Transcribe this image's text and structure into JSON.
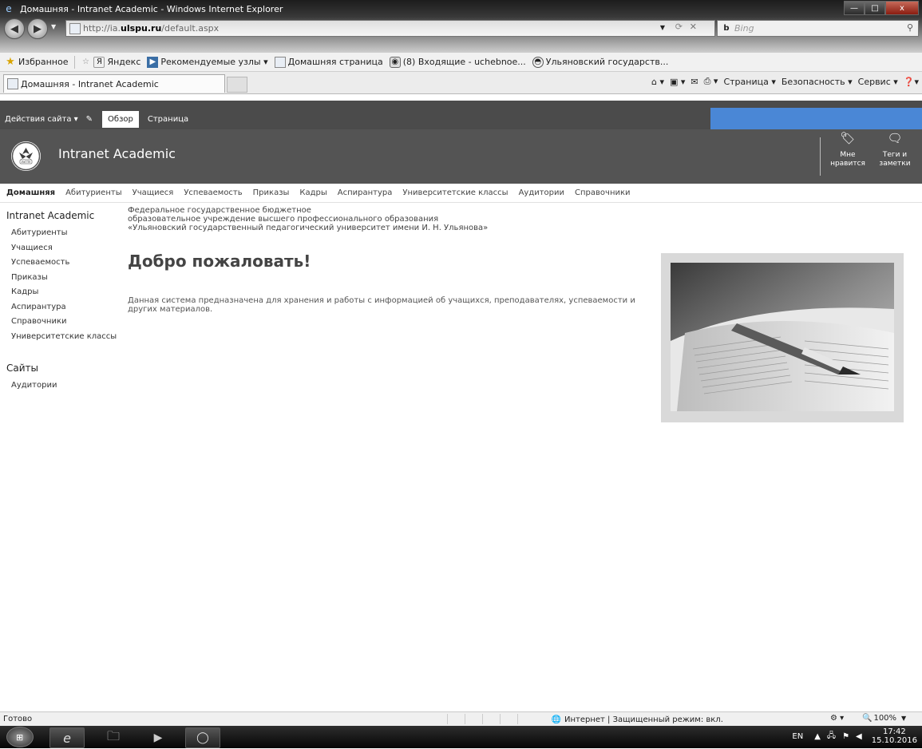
{
  "window": {
    "title": "Домашняя - Intranet Academic - Windows Internet Explorer",
    "buttons": [
      "—",
      "□",
      "x"
    ]
  },
  "address_bar": {
    "url_prefix": "http://ia.",
    "url_host": "ulspu.ru",
    "url_path": "/default.aspx",
    "search_placeholder": "Bing"
  },
  "favorites_bar": {
    "favorites_label": "Избранное",
    "items": [
      "Яндекс",
      "Рекомендуемые узлы ▾",
      "Домашняя страница",
      "(8) Входящие - uchebnoe...",
      "Ульяновский государств..."
    ]
  },
  "tab": {
    "label": "Домашняя - Intranet Academic"
  },
  "command_bar": {
    "page": "Страница ▾",
    "safety": "Безопасность ▾",
    "tools": "Сервис ▾"
  },
  "ribbon": {
    "site_actions": "Действия сайта ▾",
    "tabs": [
      "Обзор",
      "Страница"
    ]
  },
  "banner": {
    "logo_text": "УлГПУ",
    "site_name": "Intranet Academic",
    "like_label": "Мне нравится",
    "tags_label": "Теги и заметки"
  },
  "top_nav": {
    "items": [
      "Домашняя",
      "Абитуриенты",
      "Учащиеся",
      "Успеваемость",
      "Приказы",
      "Кадры",
      "Аспирантура",
      "Университетские классы",
      "Аудитории",
      "Справочники"
    ]
  },
  "left_nav": {
    "heading": "Intranet Academic",
    "items": [
      "Абитуриенты",
      "Учащиеся",
      "Успеваемость",
      "Приказы",
      "Кадры",
      "Аспирантура",
      "Справочники",
      "Университетские классы"
    ],
    "sites_heading": "Сайты",
    "sites_items": [
      "Аудитории"
    ]
  },
  "content": {
    "org_line1": "Федеральное государственное бюджетное",
    "org_line2": "образовательное учреждение высшего профессионального образования",
    "org_line3": "«Ульяновский государственный педагогический университет имени И. Н. Ульянова»",
    "welcome": "Добро пожаловать!",
    "description_line1": "Данная система предназначена для хранения и работы с информацией об учащихся, преподавателях, успеваемости и",
    "description_line2": "других материалов."
  },
  "status_bar": {
    "ready": "Готово",
    "zone": "Интернет | Защищенный режим: вкл.",
    "zoom": "100%"
  },
  "taskbar": {
    "lang": "EN",
    "time": "17:42",
    "date": "15.10.2016"
  }
}
